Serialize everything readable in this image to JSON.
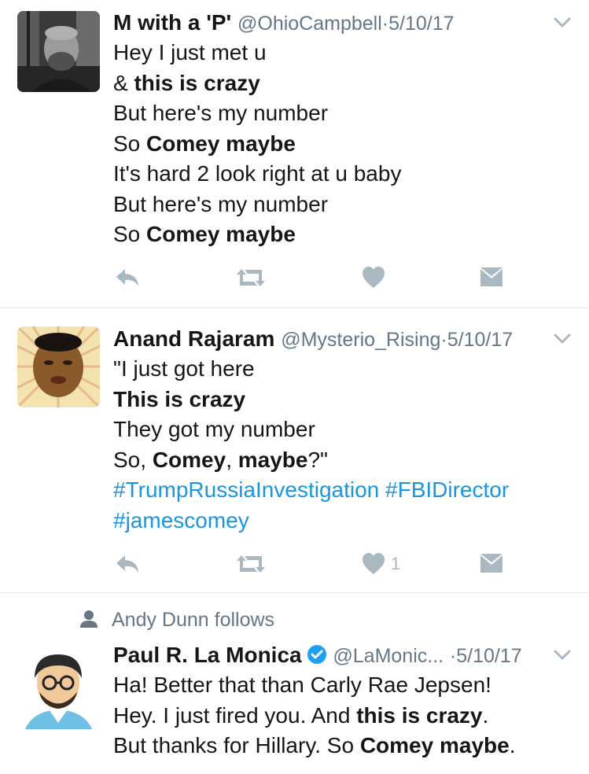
{
  "tweets": [
    {
      "name": "M with a 'P'",
      "handle": "@OhioCampbell",
      "date": "5/10/17",
      "lines": [
        [
          {
            "t": "Hey I just met u"
          }
        ],
        [
          {
            "t": "& "
          },
          {
            "t": "this is crazy",
            "b": true
          }
        ],
        [
          {
            "t": "But here's my number"
          }
        ],
        [
          {
            "t": "So "
          },
          {
            "t": "Comey maybe",
            "b": true
          }
        ],
        [
          {
            "t": "It's hard 2 look right at u baby"
          }
        ],
        [
          {
            "t": "But here's my number"
          }
        ],
        [
          {
            "t": "So "
          },
          {
            "t": "Comey maybe",
            "b": true
          }
        ]
      ],
      "like_count": ""
    },
    {
      "name": "Anand Rajaram",
      "handle": "@Mysterio_Rising",
      "date": "5/10/17",
      "lines": [
        [
          {
            "t": "\"I just got here"
          }
        ],
        [
          {
            "t": "This is crazy",
            "b": true
          }
        ],
        [
          {
            "t": "They got my number"
          }
        ],
        [
          {
            "t": "So, "
          },
          {
            "t": "Comey",
            "b": true
          },
          {
            "t": ", "
          },
          {
            "t": "maybe",
            "b": true
          },
          {
            "t": "?\""
          }
        ],
        [
          {
            "t": "#TrumpRussiaInvestigation",
            "h": true
          },
          {
            "t": " "
          },
          {
            "t": "#FBIDirector",
            "h": true
          }
        ],
        [
          {
            "t": "#jamescomey",
            "h": true
          }
        ]
      ],
      "like_count": "1"
    },
    {
      "social_context": "Andy Dunn follows",
      "name": "Paul R. La Monica",
      "verified": true,
      "handle": "@LaMonic...",
      "date": "5/10/17",
      "lines": [
        [
          {
            "t": "Ha! Better that than Carly Rae Jepsen!"
          }
        ],
        [
          {
            "t": "Hey. I just fired you. And "
          },
          {
            "t": "this is crazy",
            "b": true
          },
          {
            "t": "."
          }
        ],
        [
          {
            "t": "But thanks for Hillary. So "
          },
          {
            "t": "Comey maybe",
            "b": true
          },
          {
            "t": "."
          }
        ]
      ]
    }
  ],
  "separator": "·",
  "icons": {
    "reply": "reply-icon",
    "retweet": "retweet-icon",
    "like": "heart-icon",
    "dm": "envelope-icon",
    "caret": "chevron-down-icon",
    "verified": "verified-badge-icon",
    "follows": "person-icon"
  },
  "colors": {
    "text": "#14171a",
    "secondary": "#657786",
    "icon": "#aab8c2",
    "link": "#1b95e0",
    "verified": "#1da1f2",
    "divider": "#e1e8ed"
  }
}
